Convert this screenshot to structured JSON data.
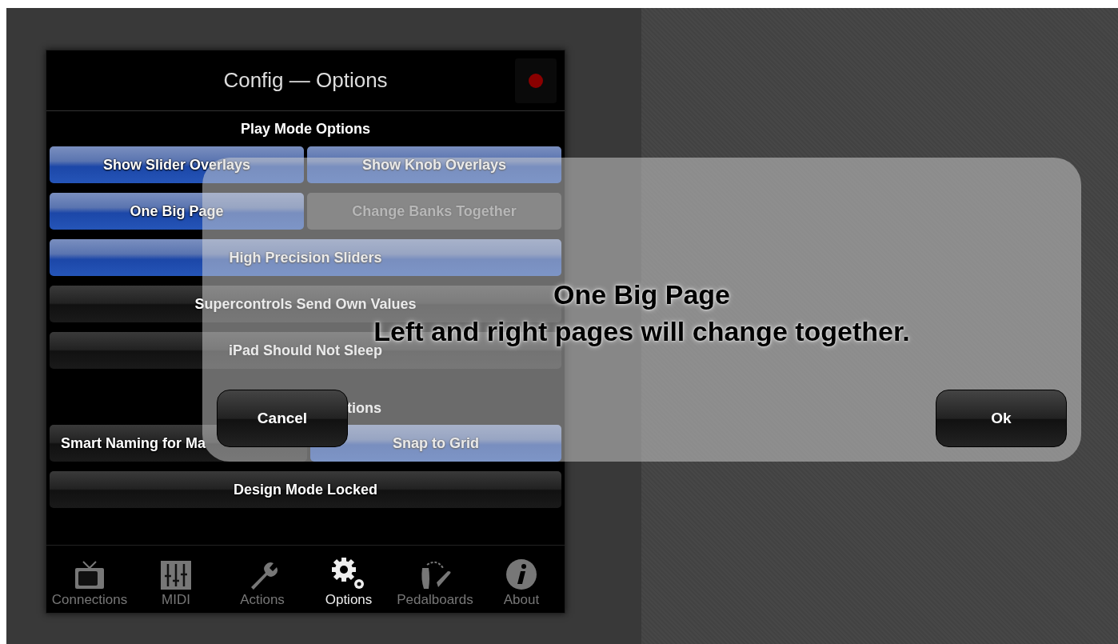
{
  "header": {
    "title": "Config — Options",
    "record_indicator": {
      "on": true
    }
  },
  "sections": [
    {
      "heading": "Play Mode Options",
      "rows": [
        [
          {
            "label": "Show Slider Overlays",
            "selected": true,
            "disabled": false
          },
          {
            "label": "Show Knob Overlays",
            "selected": true,
            "disabled": false
          }
        ],
        [
          {
            "label": "One Big Page",
            "selected": true,
            "disabled": false
          },
          {
            "label": "Change Banks Together",
            "selected": false,
            "disabled": true
          }
        ],
        [
          {
            "label": "High Precision Sliders",
            "selected": true,
            "disabled": false
          }
        ],
        [
          {
            "label": "Supercontrols Send Own Values",
            "selected": false,
            "disabled": false
          }
        ],
        [
          {
            "label": "iPad Should Not Sleep",
            "selected": false,
            "disabled": false
          }
        ]
      ]
    },
    {
      "heading": "tions",
      "rows": [
        [
          {
            "label": "Smart Naming for Ma",
            "selected": false,
            "disabled": false
          },
          {
            "label": "Snap to Grid",
            "selected": true,
            "disabled": false
          }
        ],
        [
          {
            "label": "Design Mode Locked",
            "selected": false,
            "disabled": false
          }
        ]
      ]
    }
  ],
  "tabs": [
    {
      "label": "Connections",
      "kind": "tv",
      "selected": false
    },
    {
      "label": "MIDI",
      "kind": "mixer",
      "selected": false
    },
    {
      "label": "Actions",
      "kind": "wrench",
      "selected": false
    },
    {
      "label": "Options",
      "kind": "gears",
      "selected": true
    },
    {
      "label": "Pedalboards",
      "kind": "footprints",
      "selected": false
    },
    {
      "label": "About",
      "kind": "info",
      "selected": false
    }
  ],
  "dialog": {
    "title": "One Big Page",
    "message": "Left and right pages will change together.",
    "buttons": [
      "Cancel",
      "Ok"
    ]
  }
}
